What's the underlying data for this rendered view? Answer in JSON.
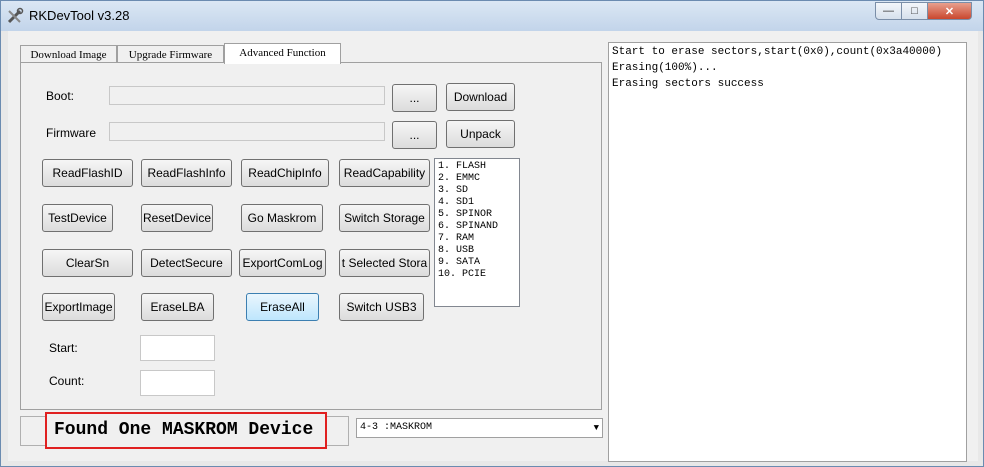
{
  "window": {
    "title": "RKDevTool v3.28",
    "controls": {
      "minimize": "—",
      "maximize": "□",
      "close": "✕"
    }
  },
  "tabs": [
    {
      "label": "Download Image",
      "active": false
    },
    {
      "label": "Upgrade Firmware",
      "active": false
    },
    {
      "label": "Advanced Function",
      "active": true
    }
  ],
  "advanced": {
    "boot_label": "Boot:",
    "boot_value": "",
    "firmware_label": "Firmware",
    "firmware_value": "",
    "browse_label": "...",
    "download_label": "Download",
    "unpack_label": "Unpack",
    "buttons": {
      "read_flash_id": "ReadFlashID",
      "read_flash_info": "ReadFlashInfo",
      "read_chip_info": "ReadChipInfo",
      "read_capability": "ReadCapability",
      "test_device": "TestDevice",
      "reset_device": "ResetDevice",
      "go_maskrom": "Go Maskrom",
      "switch_storage": "Switch Storage",
      "clear_sn": "ClearSn",
      "detect_secure": "DetectSecure",
      "export_com_log": "ExportComLog",
      "export_selected_storage": "t Selected Stora",
      "export_image": "ExportImage",
      "erase_lba": "EraseLBA",
      "erase_all": "EraseAll",
      "switch_usb3": "Switch USB3"
    },
    "storage_list": [
      "1. FLASH",
      "2. EMMC",
      "3. SD",
      "4. SD1",
      "5. SPINOR",
      "6. SPINAND",
      "7. RAM",
      "8. USB",
      "9. SATA",
      "10. PCIE"
    ],
    "start_label": "Start:",
    "start_value": "",
    "count_label": "Count:",
    "count_value": ""
  },
  "status": {
    "message": "Found One MASKROM Device",
    "device_select": "4-3 :MASKROM",
    "highlight_color": "#e02020"
  },
  "log": {
    "lines": [
      "Start to erase sectors,start(0x0),count(0x3a40000)",
      "Erasing(100%)...",
      "Erasing sectors success"
    ]
  }
}
